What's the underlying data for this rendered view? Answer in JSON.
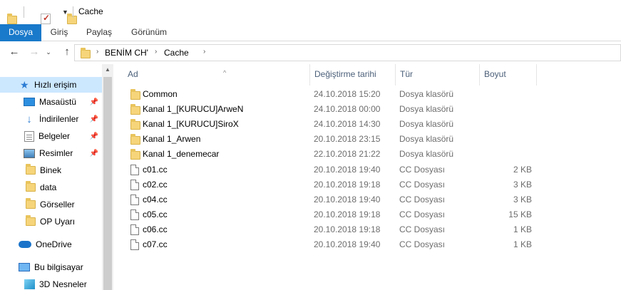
{
  "window": {
    "title": "Cache"
  },
  "ribbon": {
    "tabs": [
      "Dosya",
      "Giriş",
      "Paylaş",
      "Görünüm"
    ]
  },
  "address": {
    "crumbs": [
      "BENİM CH'",
      "Cache"
    ]
  },
  "nav_pane": {
    "items": [
      {
        "label": "Hızlı erişim",
        "icon": "star-icon",
        "selected": true
      },
      {
        "label": "Masaüstü",
        "icon": "desktop-icon",
        "pinned": true
      },
      {
        "label": "İndirilenler",
        "icon": "download-icon",
        "pinned": true
      },
      {
        "label": "Belgeler",
        "icon": "documents-icon",
        "pinned": true
      },
      {
        "label": "Resimler",
        "icon": "pictures-icon",
        "pinned": true
      },
      {
        "label": "Binek",
        "icon": "folder-icon"
      },
      {
        "label": "data",
        "icon": "folder-icon"
      },
      {
        "label": "Görseller",
        "icon": "folder-icon"
      },
      {
        "label": "OP Uyarı",
        "icon": "folder-icon"
      },
      {
        "label": "OneDrive",
        "icon": "onedrive-icon"
      },
      {
        "label": "Bu bilgisayar",
        "icon": "computer-icon"
      },
      {
        "label": "3D Nesneler",
        "icon": "3d-objects-icon"
      }
    ]
  },
  "columns": {
    "name": "Ad",
    "date": "Değiştirme tarihi",
    "type": "Tür",
    "size": "Boyut"
  },
  "files": [
    {
      "name": "Common",
      "date": "24.10.2018 15:20",
      "type": "Dosya klasörü",
      "size": "",
      "kind": "folder"
    },
    {
      "name": "Kanal 1_[KURUCU]ArweN",
      "date": "24.10.2018 00:00",
      "type": "Dosya klasörü",
      "size": "",
      "kind": "folder"
    },
    {
      "name": "Kanal 1_[KURUCU]SiroX",
      "date": "24.10.2018 14:30",
      "type": "Dosya klasörü",
      "size": "",
      "kind": "folder"
    },
    {
      "name": "Kanal 1_Arwen",
      "date": "20.10.2018 23:15",
      "type": "Dosya klasörü",
      "size": "",
      "kind": "folder"
    },
    {
      "name": "Kanal 1_denemecar",
      "date": "22.10.2018 21:22",
      "type": "Dosya klasörü",
      "size": "",
      "kind": "folder"
    },
    {
      "name": "c01.cc",
      "date": "20.10.2018 19:40",
      "type": "CC Dosyası",
      "size": "2 KB",
      "kind": "file"
    },
    {
      "name": "c02.cc",
      "date": "20.10.2018 19:18",
      "type": "CC Dosyası",
      "size": "3 KB",
      "kind": "file"
    },
    {
      "name": "c04.cc",
      "date": "20.10.2018 19:40",
      "type": "CC Dosyası",
      "size": "3 KB",
      "kind": "file"
    },
    {
      "name": "c05.cc",
      "date": "20.10.2018 19:18",
      "type": "CC Dosyası",
      "size": "15 KB",
      "kind": "file"
    },
    {
      "name": "c06.cc",
      "date": "20.10.2018 19:18",
      "type": "CC Dosyası",
      "size": "1 KB",
      "kind": "file"
    },
    {
      "name": "c07.cc",
      "date": "20.10.2018 19:40",
      "type": "CC Dosyası",
      "size": "1 KB",
      "kind": "file"
    }
  ],
  "colors": {
    "accent": "#1979ca",
    "selection": "#cce8ff",
    "header_text": "#4c607a",
    "folder": "#f6d57a"
  }
}
